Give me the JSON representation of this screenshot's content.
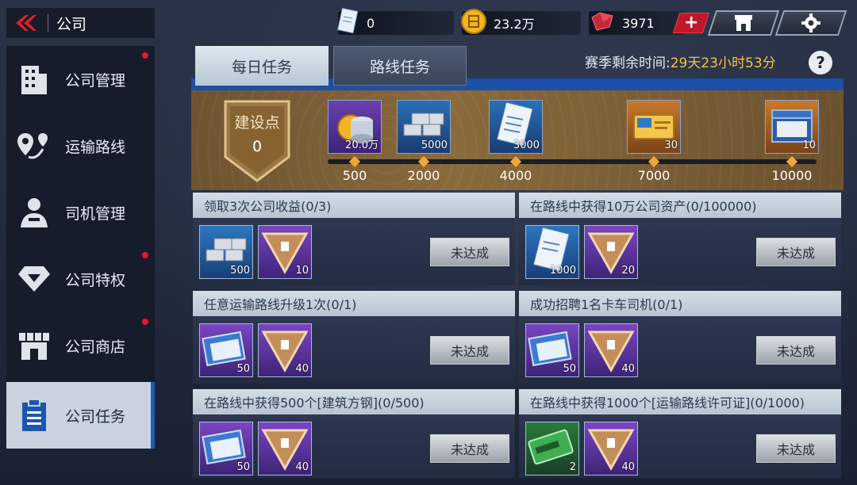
{
  "header": {
    "title": "公司",
    "resources": [
      {
        "icon": "permit-doc-icon",
        "value": "0"
      },
      {
        "icon": "coin-icon",
        "value": "23.2万"
      },
      {
        "icon": "gem-icon",
        "value": "3971"
      }
    ]
  },
  "sidebar": {
    "items": [
      {
        "label": "公司管理",
        "icon": "building-icon",
        "dot": true,
        "active": false
      },
      {
        "label": "运输路线",
        "icon": "route-pin-icon",
        "dot": false,
        "active": false
      },
      {
        "label": "司机管理",
        "icon": "driver-icon",
        "dot": false,
        "active": false
      },
      {
        "label": "公司特权",
        "icon": "diamond-icon",
        "dot": true,
        "active": false
      },
      {
        "label": "公司商店",
        "icon": "store-icon",
        "dot": true,
        "active": false
      },
      {
        "label": "公司任务",
        "icon": "clipboard-icon",
        "dot": false,
        "active": true
      }
    ]
  },
  "tabs": [
    {
      "label": "每日任务",
      "active": true
    },
    {
      "label": "路线任务",
      "active": false
    }
  ],
  "season": {
    "label": "赛季剩余时间:",
    "value": "29天23小时53分"
  },
  "progress": {
    "badge_label": "建设点",
    "badge_value": "0",
    "milestones": [
      "500",
      "2000",
      "4000",
      "7000",
      "10000"
    ],
    "rewards": [
      {
        "icon": "coin-stack-icon",
        "qty": "20.0万",
        "tier": "purple"
      },
      {
        "icon": "steel-bars-icon",
        "qty": "5000",
        "tier": "blue"
      },
      {
        "icon": "permit-doc-icon",
        "qty": "3000",
        "tier": "blue"
      },
      {
        "icon": "driver-ticket-icon",
        "qty": "30",
        "tier": "orange"
      },
      {
        "icon": "crate-icon",
        "qty": "10",
        "tier": "orange"
      }
    ]
  },
  "tasks": [
    {
      "title": "领取3次公司收益(0/3)",
      "items": [
        {
          "icon": "steel-bars-icon",
          "qty": "500",
          "tier": "blue"
        },
        {
          "icon": "build-point-icon",
          "qty": "10",
          "tier": "purple"
        }
      ],
      "button": "未达成"
    },
    {
      "title": "在路线中获得10万公司资产(0/100000)",
      "items": [
        {
          "icon": "permit-doc-icon",
          "qty": "1000",
          "tier": "blue"
        },
        {
          "icon": "build-point-icon",
          "qty": "20",
          "tier": "purple"
        }
      ],
      "button": "未达成"
    },
    {
      "title": "任意运输路线升级1次(0/1)",
      "items": [
        {
          "icon": "recruit-ticket-icon",
          "qty": "50",
          "tier": "purple"
        },
        {
          "icon": "build-point-icon",
          "qty": "40",
          "tier": "purple"
        }
      ],
      "button": "未达成"
    },
    {
      "title": "成功招聘1名卡车司机(0/1)",
      "items": [
        {
          "icon": "recruit-ticket-icon",
          "qty": "50",
          "tier": "purple"
        },
        {
          "icon": "build-point-icon",
          "qty": "40",
          "tier": "purple"
        }
      ],
      "button": "未达成"
    },
    {
      "title": "在路线中获得500个[建筑方钢](0/500)",
      "items": [
        {
          "icon": "recruit-ticket-icon",
          "qty": "50",
          "tier": "purple"
        },
        {
          "icon": "build-point-icon",
          "qty": "40",
          "tier": "purple"
        }
      ],
      "button": "未达成"
    },
    {
      "title": "在路线中获得1000个[运输路线许可证](0/1000)",
      "items": [
        {
          "icon": "expansion-card-icon",
          "qty": "2",
          "tier": "green"
        },
        {
          "icon": "build-point-icon",
          "qty": "40",
          "tier": "purple"
        }
      ],
      "button": "未达成"
    }
  ]
}
